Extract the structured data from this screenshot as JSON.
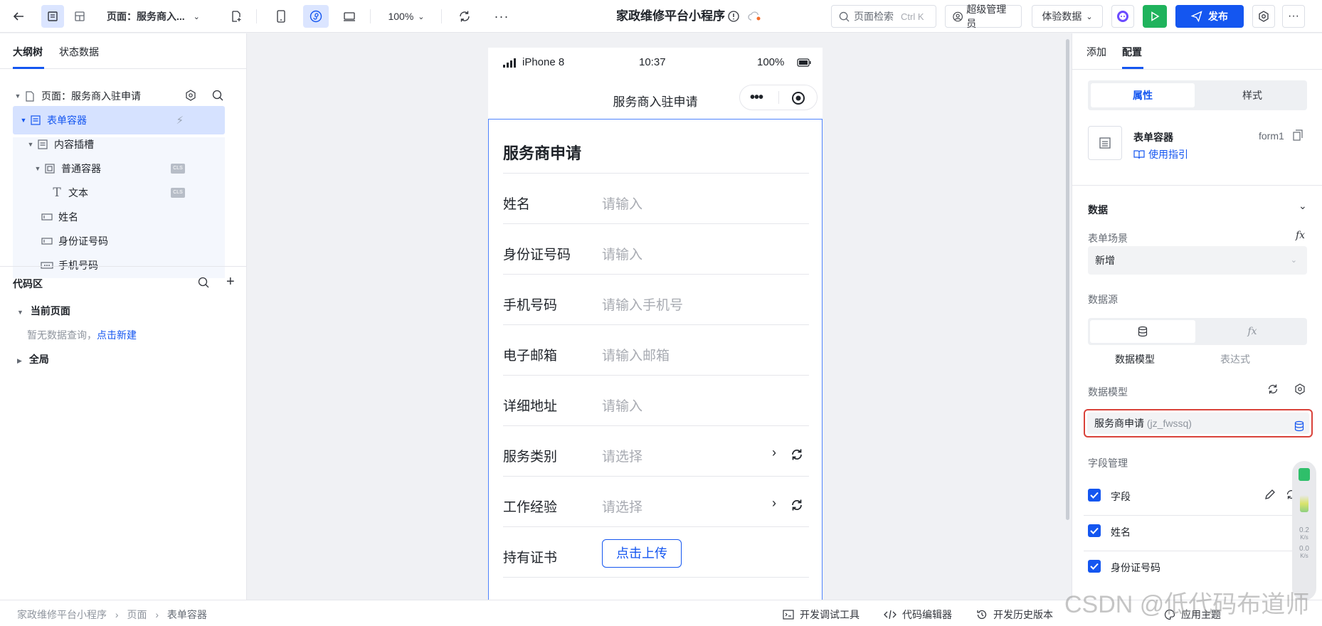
{
  "topbar": {
    "page_select": "页面：服务商入...",
    "zoom": "100%",
    "app_title": "家政维修平台小程序",
    "search_placeholder": "页面检索",
    "search_shortcut": "Ctrl K",
    "role": "超级管理员",
    "data_mode": "体验数据",
    "publish_label": "发布"
  },
  "left_panel": {
    "tabs": [
      "大纲树",
      "状态数据"
    ],
    "tree": [
      {
        "label": "页面：服务商入驻申请"
      },
      {
        "label": "表单容器"
      },
      {
        "label": "内容插槽"
      },
      {
        "label": "普通容器",
        "badge": "CLS"
      },
      {
        "label": "文本",
        "badge": "CLS"
      },
      {
        "label": "姓名"
      },
      {
        "label": "身份证号码"
      },
      {
        "label": "手机号码"
      }
    ],
    "code_area": {
      "title": "代码区",
      "current_page": "当前页面",
      "empty_text": "暂无数据查询，",
      "create_link": "点击新建",
      "global": "全局"
    }
  },
  "phone": {
    "carrier": "iPhone 8",
    "time": "10:37",
    "battery": "100%",
    "nav_title": "服务商入驻申请",
    "form_title": "服务商申请",
    "fields": [
      {
        "label": "姓名",
        "placeholder": "请输入"
      },
      {
        "label": "身份证号码",
        "placeholder": "请输入"
      },
      {
        "label": "手机号码",
        "placeholder": "请输入手机号"
      },
      {
        "label": "电子邮箱",
        "placeholder": "请输入邮箱"
      },
      {
        "label": "详细地址",
        "placeholder": "请输入"
      },
      {
        "label": "服务类别",
        "placeholder": "请选择"
      },
      {
        "label": "工作经验",
        "placeholder": "请选择"
      },
      {
        "label": "持有证书",
        "button": "点击上传"
      }
    ]
  },
  "bottombar": {
    "breadcrumb": [
      "家政维修平台小程序",
      "页面",
      "表单容器"
    ],
    "tools": [
      "开发调试工具",
      "代码编辑器",
      "开发历史版本",
      "应用主题"
    ],
    "watermark": "CSDN @低代码布道师"
  },
  "right_panel": {
    "tabs": [
      "添加",
      "配置"
    ],
    "segment": [
      "属性",
      "样式"
    ],
    "component_name": "表单容器",
    "component_id": "form1",
    "guide_link": "使用指引",
    "section_data": "数据",
    "form_scene_label": "表单场景",
    "form_scene_value": "新增",
    "datasource_label": "数据源",
    "datasource_options": [
      "数据模型",
      "表达式"
    ],
    "data_model_label": "数据模型",
    "data_model_name": "服务商申请",
    "data_model_code": "(jz_fwssq)",
    "field_mgmt_label": "字段管理",
    "field_items": [
      "字段",
      "姓名",
      "身份证号码"
    ]
  },
  "side_widget": {
    "up": "0.2",
    "down": "0.0",
    "unit": "K/s"
  },
  "colors": {
    "accent": "#1456f0",
    "run": "#1fb35c",
    "highlight": "#d9423a"
  }
}
